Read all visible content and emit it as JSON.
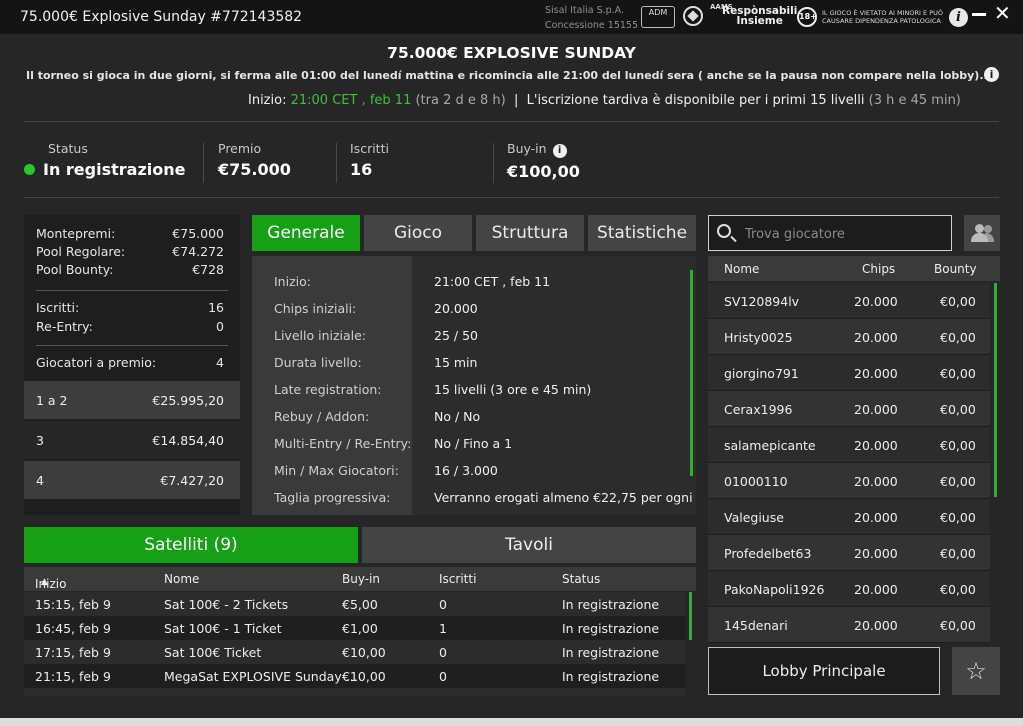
{
  "window": {
    "title": "75.000€ Explosive Sunday #772143582",
    "operator_line1": "Sisal Italia S.p.A.",
    "operator_line2": "Concessione 15155",
    "adm_label": "ADM",
    "aams_label": "AAMS",
    "responsabili_line1": "Respònsabili",
    "responsabili_line2": "Insieme",
    "age_badge": "18+",
    "underage_line1": "IL GIOCO È VIETATO AI MINORI E PUÒ",
    "underage_line2": "CAUSARE DIPENDENZA PATOLOGICA",
    "info_icon": "i",
    "close_icon": "✕"
  },
  "header": {
    "title": "75.000€ EXPLOSIVE SUNDAY",
    "notice": "Il torneo si gioca in due giorni, si ferma alle 01:00 del lunedí mattina e ricomincia alle 21:00 del lunedí sera ( anche se la pausa non compare nella lobby)....",
    "start_label": "Inizio:",
    "start_time": "21:00 CET , feb 11",
    "start_countdown": "(tra 2 d e 8 h)",
    "separator": "|",
    "late_reg_text": "L'iscrizione tardiva è disponibile per i primi 15 livelli",
    "late_reg_time": "(3 h e 45 min)"
  },
  "summary": {
    "status_label": "Status",
    "status_value": "In registrazione",
    "prize_label": "Premio",
    "prize_value": "€75.000",
    "entrants_label": "Iscritti",
    "entrants_value": "16",
    "buyin_label": "Buy-in",
    "buyin_value": "€100,00",
    "status_color": "#28c828"
  },
  "prize_pool": {
    "rows": [
      {
        "label": "Montepremi:",
        "value": "€75.000"
      },
      {
        "label": "Pool Regolare:",
        "value": "€74.272"
      },
      {
        "label": "Pool Bounty:",
        "value": "€728"
      }
    ],
    "entries": [
      {
        "label": "Iscritti:",
        "value": "16"
      },
      {
        "label": "Re-Entry:",
        "value": "0"
      }
    ],
    "paid_label": "Giocatori a premio:",
    "paid_value": "4",
    "payouts": [
      {
        "place": "1  a  2",
        "amount": "€25.995,20"
      },
      {
        "place": "3",
        "amount": "€14.854,40"
      },
      {
        "place": "4",
        "amount": "€7.427,20"
      }
    ]
  },
  "tabs": [
    {
      "label": "Generale",
      "active": true
    },
    {
      "label": "Gioco",
      "active": false
    },
    {
      "label": "Struttura",
      "active": false
    },
    {
      "label": "Statistiche",
      "active": false
    }
  ],
  "general_info": [
    {
      "label": "Inizio:",
      "value": "21:00 CET , feb 11"
    },
    {
      "label": "Chips iniziali:",
      "value": "20.000"
    },
    {
      "label": "Livello iniziale:",
      "value": "25 / 50"
    },
    {
      "label": "Durata livello:",
      "value": "15 min"
    },
    {
      "label": "Late registration:",
      "value": "15 livelli (3 ore e 45 min)"
    },
    {
      "label": "Rebuy / Addon:",
      "value": "No / No"
    },
    {
      "label": "Multi-Entry / Re-Entry:",
      "value": "No / Fino a 1"
    },
    {
      "label": "Min / Max Giocatori:",
      "value": "16 / 3.000"
    },
    {
      "label": "Taglia progressiva:",
      "value": "Verranno erogati almeno €22,75 per ogni"
    }
  ],
  "players": {
    "search_placeholder": "Trova giocatore",
    "columns": [
      "Nome",
      "Chips",
      "Bounty"
    ],
    "rows": [
      {
        "name": "SV120894lv",
        "chips": "20.000",
        "bounty": "€0,00"
      },
      {
        "name": "Hristy0025",
        "chips": "20.000",
        "bounty": "€0,00"
      },
      {
        "name": "giorgino791",
        "chips": "20.000",
        "bounty": "€0,00"
      },
      {
        "name": "Cerax1996",
        "chips": "20.000",
        "bounty": "€0,00"
      },
      {
        "name": "salamepicante",
        "chips": "20.000",
        "bounty": "€0,00"
      },
      {
        "name": "01000110",
        "chips": "20.000",
        "bounty": "€0,00"
      },
      {
        "name": "Valegiuse",
        "chips": "20.000",
        "bounty": "€0,00"
      },
      {
        "name": "Profedelbet63",
        "chips": "20.000",
        "bounty": "€0,00"
      },
      {
        "name": "PakoNapoli1926",
        "chips": "20.000",
        "bounty": "€0,00"
      },
      {
        "name": "145denari",
        "chips": "20.000",
        "bounty": "€0,00"
      }
    ]
  },
  "bottom_tabs": [
    {
      "label": "Satelliti (9)",
      "active": true
    },
    {
      "label": "Tavoli",
      "active": false
    }
  ],
  "satellites": {
    "columns": [
      "Inizio",
      "Nome",
      "Buy-in",
      "Iscritti",
      "Status"
    ],
    "sort_icon": "▲",
    "rows": [
      {
        "start": "15:15, feb 9",
        "name": "Sat 100€ - 2 Tickets",
        "buyin": "€5,00",
        "entrants": "0",
        "status": "In registrazione"
      },
      {
        "start": "16:45, feb 9",
        "name": "Sat 100€ - 1 Ticket",
        "buyin": "€1,00",
        "entrants": "1",
        "status": "In registrazione"
      },
      {
        "start": "17:15, feb 9",
        "name": "Sat 100€ Ticket",
        "buyin": "€10,00",
        "entrants": "0",
        "status": "In registrazione"
      },
      {
        "start": "21:15, feb 9",
        "name": "MegaSat EXPLOSIVE Sunday ...",
        "buyin": "€10,00",
        "entrants": "0",
        "status": "In registrazione"
      }
    ]
  },
  "actions": {
    "lobby_button": "Lobby Principale",
    "favorite_icon": "☆"
  }
}
